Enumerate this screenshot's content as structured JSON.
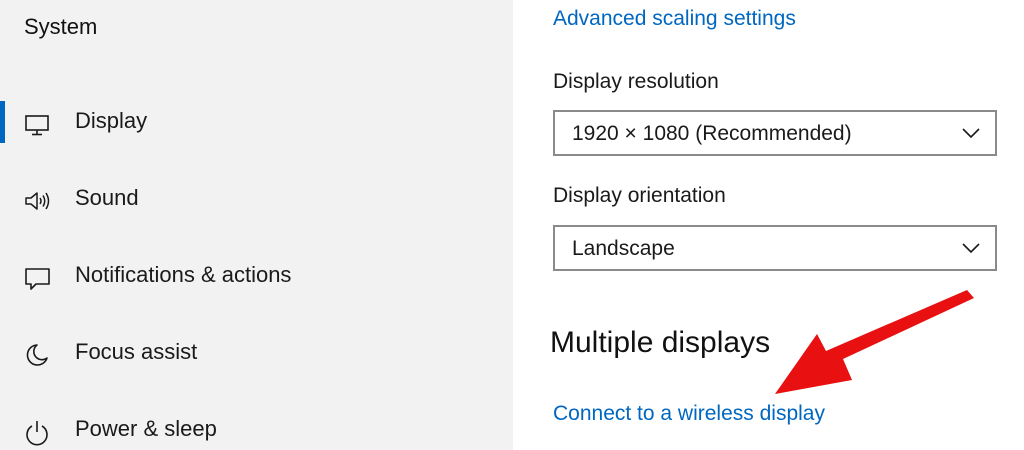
{
  "sidebar": {
    "title": "System",
    "items": [
      {
        "label": "Display",
        "icon": "monitor-icon",
        "selected": true
      },
      {
        "label": "Sound",
        "icon": "speaker-icon",
        "selected": false
      },
      {
        "label": "Notifications & actions",
        "icon": "notification-icon",
        "selected": false
      },
      {
        "label": "Focus assist",
        "icon": "moon-icon",
        "selected": false
      },
      {
        "label": "Power & sleep",
        "icon": "power-icon",
        "selected": false
      }
    ]
  },
  "main": {
    "advanced_scaling_link": "Advanced scaling settings",
    "resolution": {
      "label": "Display resolution",
      "value": "1920 × 1080 (Recommended)"
    },
    "orientation": {
      "label": "Display orientation",
      "value": "Landscape"
    },
    "multiple_displays": {
      "title": "Multiple displays",
      "connect_link": "Connect to a wireless display"
    }
  },
  "colors": {
    "accent": "#0067c0",
    "sidebar_bg": "#f2f2f2",
    "annotation_arrow": "#e81010"
  }
}
